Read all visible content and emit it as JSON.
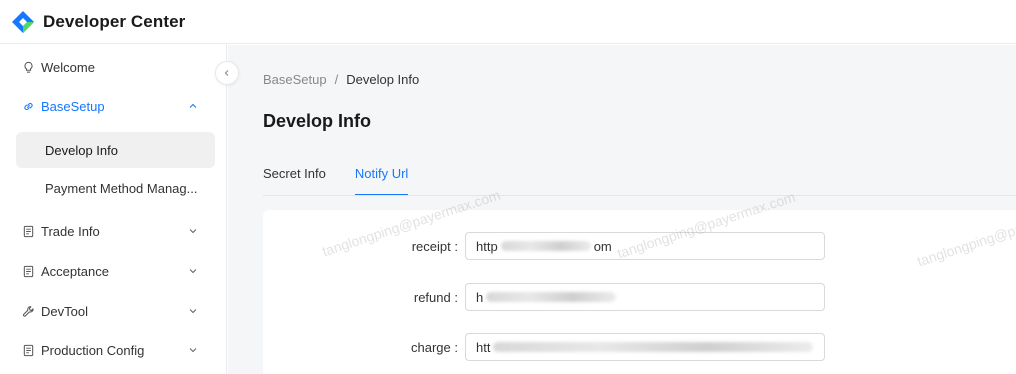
{
  "header": {
    "title": "Developer Center"
  },
  "sidebar": {
    "items": [
      {
        "label": "Welcome",
        "icon": "bulb-icon"
      },
      {
        "label": "BaseSetup",
        "icon": "link-icon",
        "expanded": true
      },
      {
        "label": "Trade Info",
        "icon": "receipt-icon"
      },
      {
        "label": "Acceptance",
        "icon": "receipt-icon"
      },
      {
        "label": "DevTool",
        "icon": "tool-icon"
      },
      {
        "label": "Production Config",
        "icon": "receipt-icon"
      }
    ],
    "subitems": [
      {
        "label": "Develop Info",
        "selected": true
      },
      {
        "label": "Payment Method Manag..."
      }
    ]
  },
  "breadcrumb": {
    "parent": "BaseSetup",
    "separator": "/",
    "current": "Develop Info"
  },
  "page": {
    "title": "Develop Info"
  },
  "tabs": [
    {
      "label": "Secret Info"
    },
    {
      "label": "Notify Url",
      "active": true
    }
  ],
  "form": {
    "fields": [
      {
        "label": "receipt",
        "colon": ":",
        "value_start": "http",
        "value_end": "om"
      },
      {
        "label": "refund",
        "colon": ":",
        "value_start": "h"
      },
      {
        "label": "charge",
        "colon": ":",
        "value_start": "htt"
      }
    ]
  },
  "watermark": {
    "text": "tanglongping@payermax.com"
  },
  "colors": {
    "accent": "#1677ff",
    "background": "#f5f6f7"
  }
}
